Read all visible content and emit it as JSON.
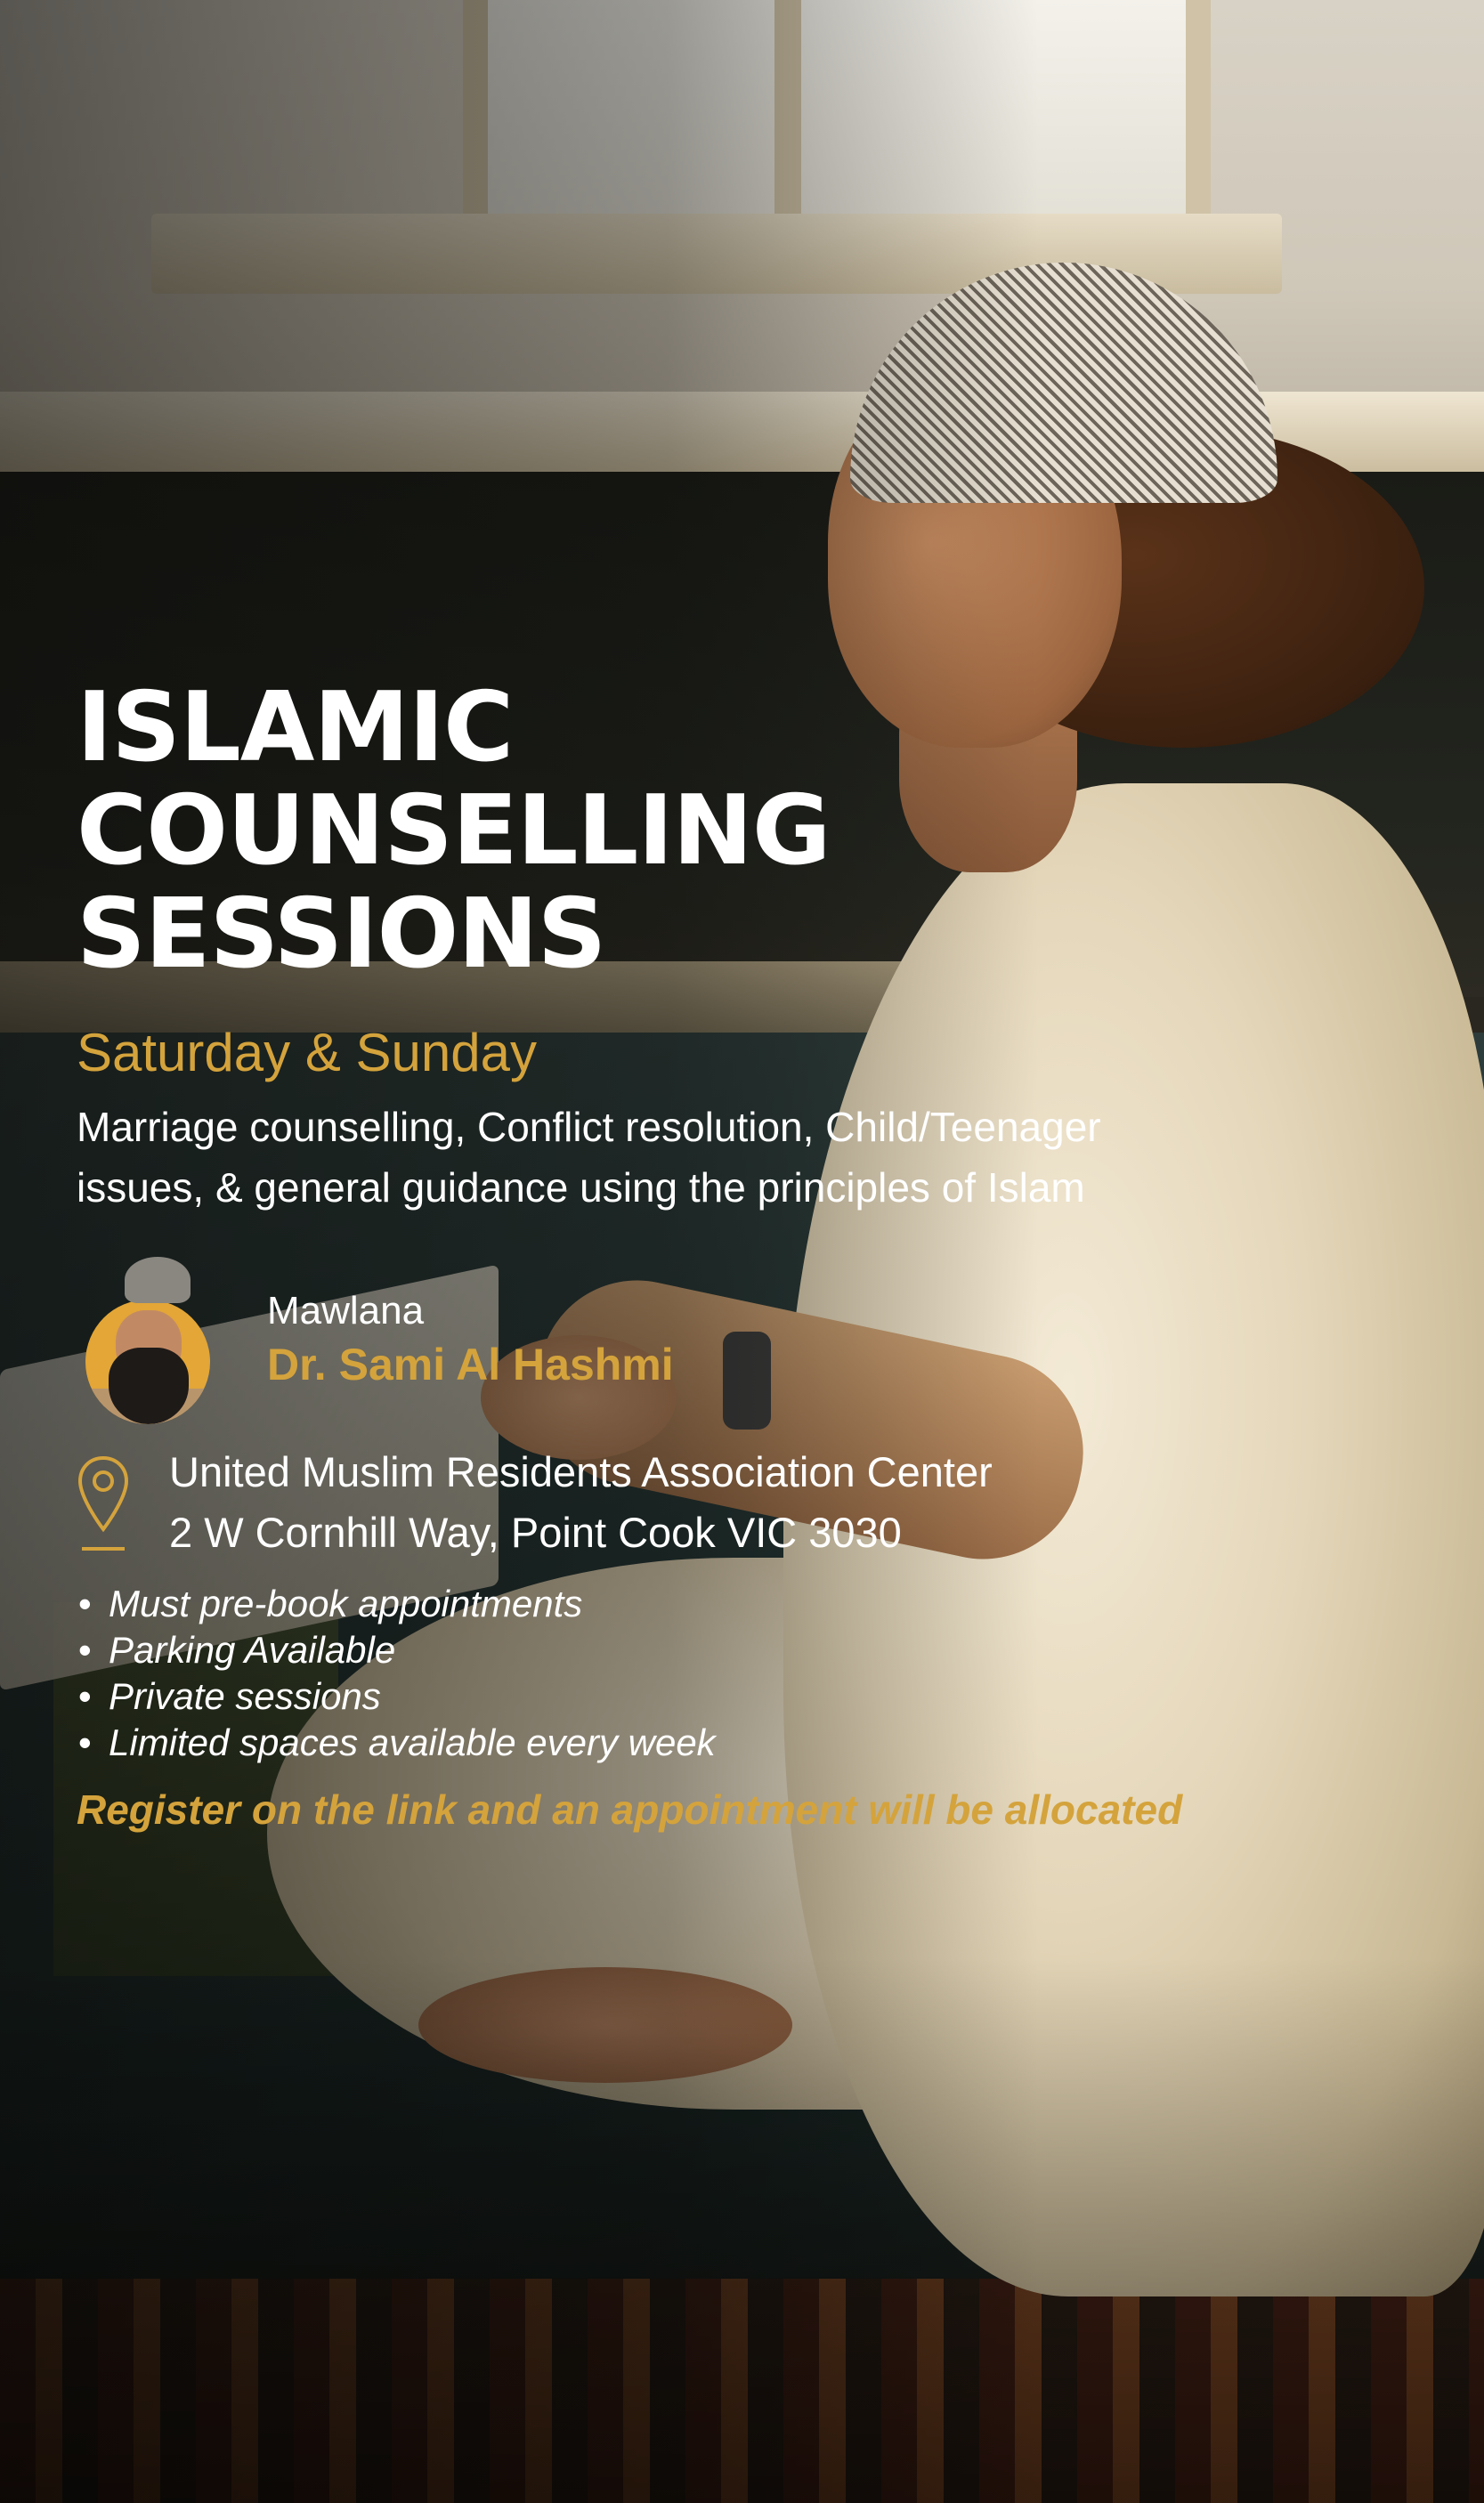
{
  "title_lines": [
    "ISLAMIC",
    "COUNSELLING",
    "SESSIONS"
  ],
  "days": "Saturday & Sunday",
  "description_lines": [
    "Marriage counselling, Conflict resolution, Child/Teenager",
    "issues, & general guidance using the principles of Islam"
  ],
  "speaker": {
    "title": "Mawlana",
    "name": "Dr. Sami Al Hashmi"
  },
  "location": {
    "icon": "location-pin-icon",
    "lines": [
      "United Muslim Residents Association Center",
      "2 W Cornhill Way, Point Cook VIC 3030"
    ]
  },
  "notes": [
    "Must pre-book appointments",
    "Parking Available",
    "Private sessions",
    "Limited spaces available every week"
  ],
  "cta": "Register on the link and an appointment will be allocated",
  "colors": {
    "accent": "#d4a33c",
    "text": "#ffffff"
  }
}
